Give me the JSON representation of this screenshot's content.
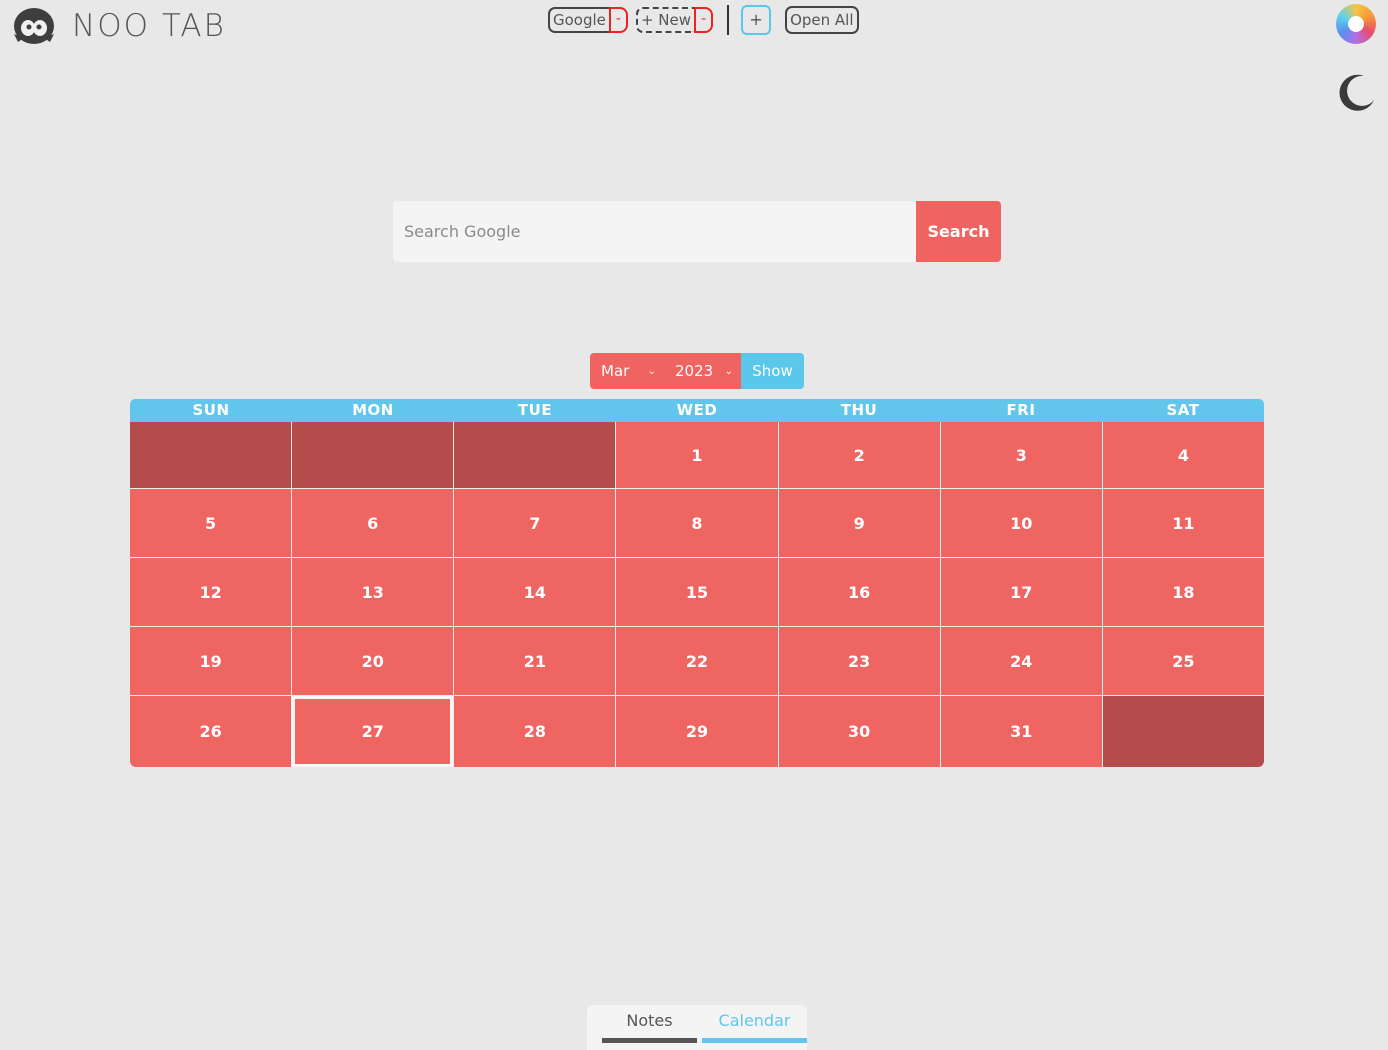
{
  "app": {
    "title": "NOO TAB",
    "logo_icon": "penguin-icon"
  },
  "bookmarks": [
    {
      "label": "Google",
      "delete_label": "-",
      "style": "solid"
    },
    {
      "label": "+ New",
      "delete_label": "-",
      "style": "dashed"
    }
  ],
  "toolbar": {
    "add_label": "+",
    "open_all_label": "Open All",
    "theme_icon": "moon-icon",
    "color_icon": "color-wheel-icon"
  },
  "search": {
    "placeholder": "Search Google",
    "value": "",
    "button_label": "Search"
  },
  "picker": {
    "month": "Mar",
    "year": "2023",
    "show_label": "Show"
  },
  "calendar": {
    "weekdays": [
      "SUN",
      "MON",
      "TUE",
      "WED",
      "THU",
      "FRI",
      "SAT"
    ],
    "leading_empty": 3,
    "days_in_month": 31,
    "trailing_empty": 1,
    "today": 27
  },
  "colors": {
    "accent": "#ef6461",
    "accent_dark": "#b44c4b",
    "secondary": "#62c6ec",
    "background": "#e8e8e8"
  },
  "tabs": [
    {
      "label": "Notes",
      "active": false
    },
    {
      "label": "Calendar",
      "active": true
    }
  ]
}
